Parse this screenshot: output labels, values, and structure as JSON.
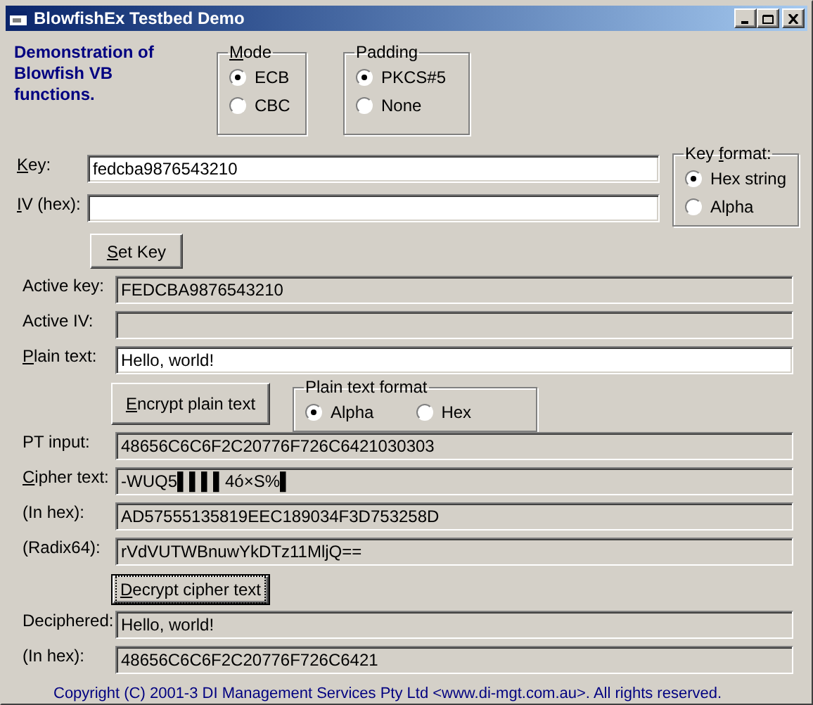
{
  "window": {
    "title": "BlowfishEx Testbed Demo"
  },
  "description": "Demonstration of Blowfish VB functions.",
  "mode": {
    "label": "Mode",
    "underline_first": true,
    "options": [
      {
        "label": "ECB",
        "selected": true
      },
      {
        "label": "CBC",
        "selected": false
      }
    ]
  },
  "padding": {
    "label": "Padding",
    "options": [
      {
        "label": "PKCS#5",
        "selected": true
      },
      {
        "label": "None",
        "selected": false
      }
    ]
  },
  "key": {
    "label": "Key:",
    "underline_first": true,
    "value": "fedcba9876543210"
  },
  "iv": {
    "label": "IV (hex):",
    "underline_first": true
  },
  "key_format": {
    "label": "Key format:",
    "underline_second_word": true,
    "options": [
      {
        "label": "Hex string",
        "selected": true
      },
      {
        "label": "Alpha",
        "selected": false
      }
    ]
  },
  "set_key_button": {
    "label": "Set Key",
    "underline_first": true
  },
  "active_fields": [
    {
      "label": "Active key:",
      "value": "FEDCBA9876543210"
    },
    {
      "label": "Active IV:"
    }
  ],
  "plain_text": {
    "label": "Plain text:",
    "underline_first": true,
    "value": "Hello, world!"
  },
  "encrypt_button": {
    "label": "Encrypt plain text",
    "underline_first": true
  },
  "plain_text_format": {
    "label": "Plain text format",
    "options": [
      {
        "label": "Alpha",
        "selected": true
      },
      {
        "label": "Hex",
        "selected": false
      }
    ]
  },
  "cipher_fields": [
    {
      "label": "PT input:",
      "value": "48656C6C6F2C20776F726C6421030303"
    },
    {
      "label": "Cipher text:",
      "underline_first": true,
      "value": "-WUQ5▌▌▌▌4ó×S%▌"
    },
    {
      "label": "(In hex):",
      "value": "AD57555135819EEC189034F3D753258D"
    },
    {
      "label": "(Radix64):",
      "value": "rVdVUTWBnuwYkDTz11MljQ=="
    }
  ],
  "decrypt_button": {
    "label": "Decrypt cipher text",
    "underline_first": true,
    "focused": true
  },
  "result_fields": [
    {
      "label": "Deciphered:",
      "value": "Hello, world!"
    },
    {
      "label": "(In hex):",
      "value": "48656C6C6F2C20776F726C6421"
    }
  ],
  "copyright": "Copyright (C) 2001-3 DI Management Services Pty Ltd <www.di-mgt.com.au>. All rights reserved."
}
